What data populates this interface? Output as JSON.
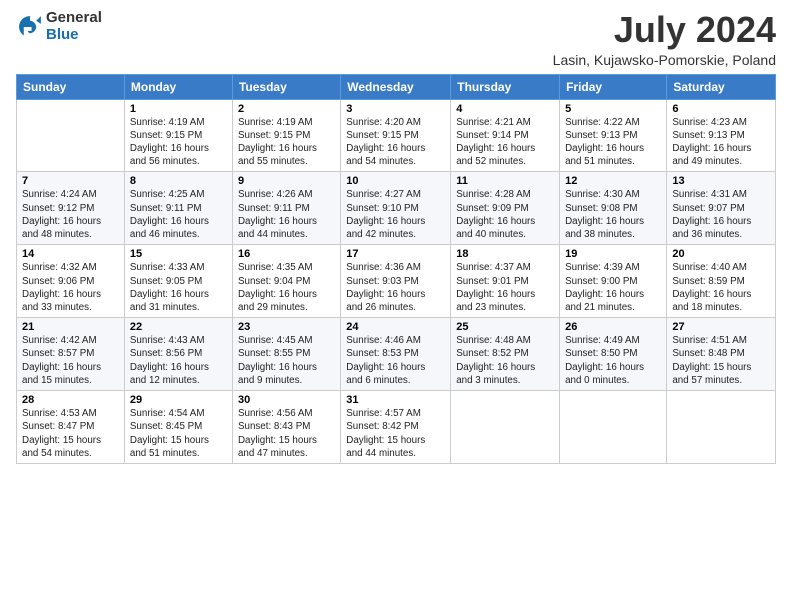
{
  "header": {
    "logo_general": "General",
    "logo_blue": "Blue",
    "title": "July 2024",
    "location": "Lasin, Kujawsko-Pomorskie, Poland"
  },
  "days_of_week": [
    "Sunday",
    "Monday",
    "Tuesday",
    "Wednesday",
    "Thursday",
    "Friday",
    "Saturday"
  ],
  "weeks": [
    [
      {
        "num": "",
        "info": ""
      },
      {
        "num": "1",
        "info": "Sunrise: 4:19 AM\nSunset: 9:15 PM\nDaylight: 16 hours\nand 56 minutes."
      },
      {
        "num": "2",
        "info": "Sunrise: 4:19 AM\nSunset: 9:15 PM\nDaylight: 16 hours\nand 55 minutes."
      },
      {
        "num": "3",
        "info": "Sunrise: 4:20 AM\nSunset: 9:15 PM\nDaylight: 16 hours\nand 54 minutes."
      },
      {
        "num": "4",
        "info": "Sunrise: 4:21 AM\nSunset: 9:14 PM\nDaylight: 16 hours\nand 52 minutes."
      },
      {
        "num": "5",
        "info": "Sunrise: 4:22 AM\nSunset: 9:13 PM\nDaylight: 16 hours\nand 51 minutes."
      },
      {
        "num": "6",
        "info": "Sunrise: 4:23 AM\nSunset: 9:13 PM\nDaylight: 16 hours\nand 49 minutes."
      }
    ],
    [
      {
        "num": "7",
        "info": "Sunrise: 4:24 AM\nSunset: 9:12 PM\nDaylight: 16 hours\nand 48 minutes."
      },
      {
        "num": "8",
        "info": "Sunrise: 4:25 AM\nSunset: 9:11 PM\nDaylight: 16 hours\nand 46 minutes."
      },
      {
        "num": "9",
        "info": "Sunrise: 4:26 AM\nSunset: 9:11 PM\nDaylight: 16 hours\nand 44 minutes."
      },
      {
        "num": "10",
        "info": "Sunrise: 4:27 AM\nSunset: 9:10 PM\nDaylight: 16 hours\nand 42 minutes."
      },
      {
        "num": "11",
        "info": "Sunrise: 4:28 AM\nSunset: 9:09 PM\nDaylight: 16 hours\nand 40 minutes."
      },
      {
        "num": "12",
        "info": "Sunrise: 4:30 AM\nSunset: 9:08 PM\nDaylight: 16 hours\nand 38 minutes."
      },
      {
        "num": "13",
        "info": "Sunrise: 4:31 AM\nSunset: 9:07 PM\nDaylight: 16 hours\nand 36 minutes."
      }
    ],
    [
      {
        "num": "14",
        "info": "Sunrise: 4:32 AM\nSunset: 9:06 PM\nDaylight: 16 hours\nand 33 minutes."
      },
      {
        "num": "15",
        "info": "Sunrise: 4:33 AM\nSunset: 9:05 PM\nDaylight: 16 hours\nand 31 minutes."
      },
      {
        "num": "16",
        "info": "Sunrise: 4:35 AM\nSunset: 9:04 PM\nDaylight: 16 hours\nand 29 minutes."
      },
      {
        "num": "17",
        "info": "Sunrise: 4:36 AM\nSunset: 9:03 PM\nDaylight: 16 hours\nand 26 minutes."
      },
      {
        "num": "18",
        "info": "Sunrise: 4:37 AM\nSunset: 9:01 PM\nDaylight: 16 hours\nand 23 minutes."
      },
      {
        "num": "19",
        "info": "Sunrise: 4:39 AM\nSunset: 9:00 PM\nDaylight: 16 hours\nand 21 minutes."
      },
      {
        "num": "20",
        "info": "Sunrise: 4:40 AM\nSunset: 8:59 PM\nDaylight: 16 hours\nand 18 minutes."
      }
    ],
    [
      {
        "num": "21",
        "info": "Sunrise: 4:42 AM\nSunset: 8:57 PM\nDaylight: 16 hours\nand 15 minutes."
      },
      {
        "num": "22",
        "info": "Sunrise: 4:43 AM\nSunset: 8:56 PM\nDaylight: 16 hours\nand 12 minutes."
      },
      {
        "num": "23",
        "info": "Sunrise: 4:45 AM\nSunset: 8:55 PM\nDaylight: 16 hours\nand 9 minutes."
      },
      {
        "num": "24",
        "info": "Sunrise: 4:46 AM\nSunset: 8:53 PM\nDaylight: 16 hours\nand 6 minutes."
      },
      {
        "num": "25",
        "info": "Sunrise: 4:48 AM\nSunset: 8:52 PM\nDaylight: 16 hours\nand 3 minutes."
      },
      {
        "num": "26",
        "info": "Sunrise: 4:49 AM\nSunset: 8:50 PM\nDaylight: 16 hours\nand 0 minutes."
      },
      {
        "num": "27",
        "info": "Sunrise: 4:51 AM\nSunset: 8:48 PM\nDaylight: 15 hours\nand 57 minutes."
      }
    ],
    [
      {
        "num": "28",
        "info": "Sunrise: 4:53 AM\nSunset: 8:47 PM\nDaylight: 15 hours\nand 54 minutes."
      },
      {
        "num": "29",
        "info": "Sunrise: 4:54 AM\nSunset: 8:45 PM\nDaylight: 15 hours\nand 51 minutes."
      },
      {
        "num": "30",
        "info": "Sunrise: 4:56 AM\nSunset: 8:43 PM\nDaylight: 15 hours\nand 47 minutes."
      },
      {
        "num": "31",
        "info": "Sunrise: 4:57 AM\nSunset: 8:42 PM\nDaylight: 15 hours\nand 44 minutes."
      },
      {
        "num": "",
        "info": ""
      },
      {
        "num": "",
        "info": ""
      },
      {
        "num": "",
        "info": ""
      }
    ]
  ]
}
